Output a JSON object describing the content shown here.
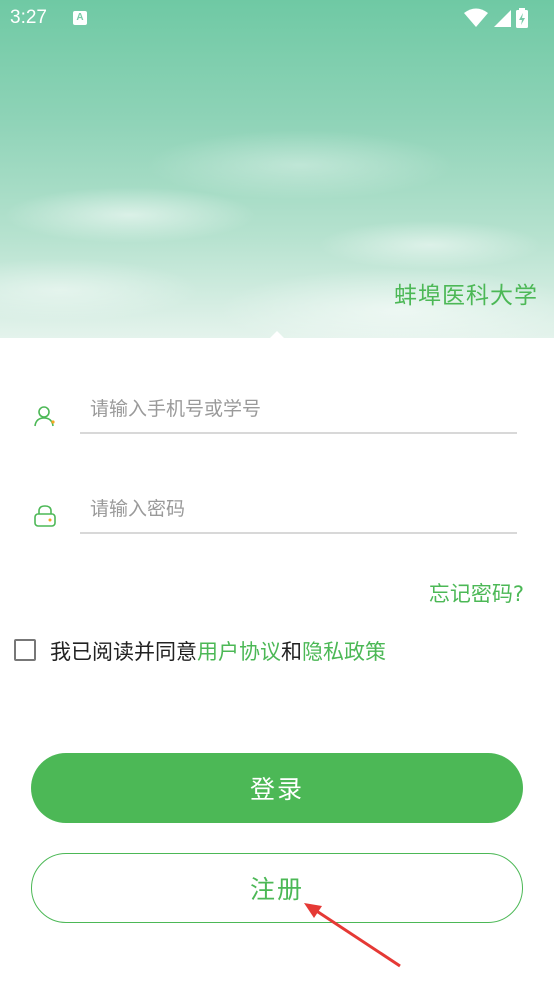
{
  "status_bar": {
    "time": "3:27",
    "notification_icon_letter": "A",
    "icons": [
      "wifi-icon",
      "signal-icon",
      "battery-icon"
    ]
  },
  "header": {
    "school_name": "蚌埠医科大学"
  },
  "login_form": {
    "account_placeholder": "请输入手机号或学号",
    "account_value": "",
    "password_placeholder": "请输入密码",
    "password_value": "",
    "forgot_password": "忘记密码?"
  },
  "agreement": {
    "checked": false,
    "prefix": "我已阅读并同意",
    "user_agreement": "用户协议",
    "and": "和",
    "privacy_policy": "隐私政策"
  },
  "buttons": {
    "login": "登录",
    "register": "注册"
  },
  "colors": {
    "accent": "#4cb856",
    "hero_top": "#6fc9a4",
    "annotation": "#e53935"
  }
}
